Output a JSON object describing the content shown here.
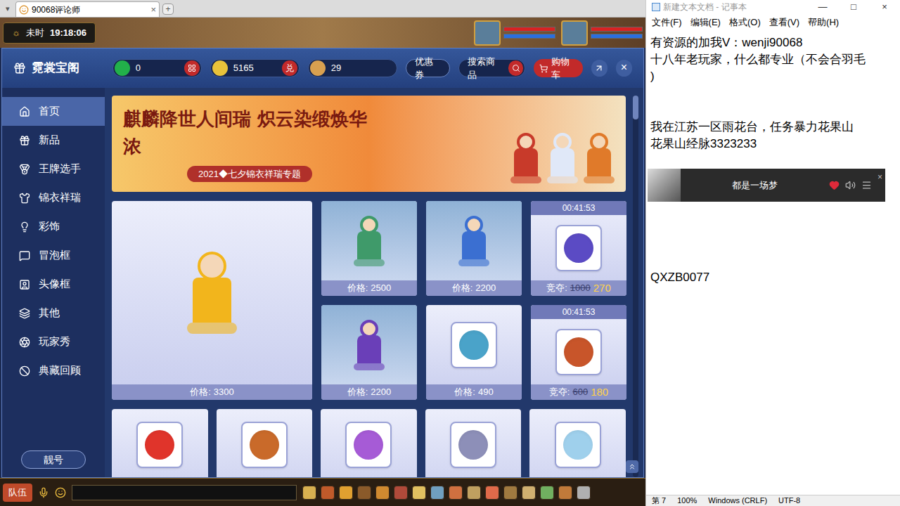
{
  "browser": {
    "menu": "▾",
    "tab_title": "90068评论师",
    "tab_close": "×",
    "new_tab": "+"
  },
  "game_hud": {
    "time_period": "未时",
    "clock": "19:18:06",
    "portraits": [
      {
        "hp": 1,
        "mp": 1
      },
      {
        "hp": 1,
        "mp": 1
      }
    ]
  },
  "shop": {
    "title": "霓裳宝阁",
    "currencies": [
      {
        "value": "0",
        "kind": "jade",
        "button_kind": "grid",
        "button": ""
      },
      {
        "value": "5165",
        "kind": "ticket",
        "button_kind": "text",
        "button": "兑"
      },
      {
        "value": "29",
        "kind": "coin",
        "button_kind": "none",
        "button": ""
      }
    ],
    "coupon": "优惠券",
    "search": "搜索商品",
    "cart": "购物车",
    "close": "×",
    "sidebar": [
      {
        "label": "首页",
        "selected": true
      },
      {
        "label": "新品",
        "selected": false
      },
      {
        "label": "王牌选手",
        "selected": false
      },
      {
        "label": "锦衣祥瑞",
        "selected": false
      },
      {
        "label": "彩饰",
        "selected": false
      },
      {
        "label": "冒泡框",
        "selected": false
      },
      {
        "label": "头像框",
        "selected": false
      },
      {
        "label": "其他",
        "selected": false
      },
      {
        "label": "玩家秀",
        "selected": false
      },
      {
        "label": "典藏回顾",
        "selected": false
      }
    ],
    "bottom_button": "靓号",
    "banner": {
      "title": "麒麟降世人间瑞 炽云染缎焕华浓",
      "subtitle": "2021◆七夕锦衣祥瑞专题"
    },
    "products": [
      {
        "kind": "large",
        "price_label": "价格:",
        "price": "3300",
        "color": "#f2b51c"
      },
      {
        "kind": "outfit",
        "price_label": "价格:",
        "price": "2500",
        "color": "#3f9a6a"
      },
      {
        "kind": "outfit",
        "price_label": "价格:",
        "price": "2200",
        "color": "#3b6fd1"
      },
      {
        "kind": "timed",
        "timer": "00:41:53",
        "price_label": "竞夺:",
        "old_price": "1000",
        "price": "270",
        "color": "#5b4bc4"
      },
      {
        "kind": "outfit",
        "price_label": "价格:",
        "price": "2200",
        "color": "#6a3fb8"
      },
      {
        "kind": "item",
        "price_label": "价格:",
        "price": "490",
        "color": "#4aa3c9"
      },
      {
        "kind": "timed",
        "timer": "00:41:53",
        "price_label": "竞夺:",
        "old_price": "600",
        "price": "180",
        "color": "#c8552a"
      }
    ],
    "more_items": [
      {
        "color": "#e0342b"
      },
      {
        "color": "#c96a2a"
      },
      {
        "color": "#a65bd6"
      },
      {
        "color": "#8d8fb8"
      },
      {
        "color": "#9fd0ec"
      }
    ]
  },
  "game_bar": {
    "team": "队伍"
  },
  "notepad": {
    "title": "新建文本文档 - 记事本",
    "controls": [
      "—",
      "□",
      "×"
    ],
    "menu": [
      "文件(F)",
      "编辑(E)",
      "格式(O)",
      "查看(V)",
      "帮助(H)"
    ],
    "lines": [
      "有资源的加我V：wenji90068",
      "十八年老玩家，什么都专业（不会合羽毛",
      ")",
      "",
      "",
      "我在江苏一区雨花台，任务暴力花果山",
      "花果山经脉3323233"
    ],
    "player": {
      "song": "都是一场梦",
      "close": "×"
    },
    "lines_after": [
      "",
      "",
      "",
      "",
      "QXZB0077"
    ],
    "status": [
      "第 7",
      "100%",
      "Windows (CRLF)",
      "UTF-8"
    ]
  }
}
